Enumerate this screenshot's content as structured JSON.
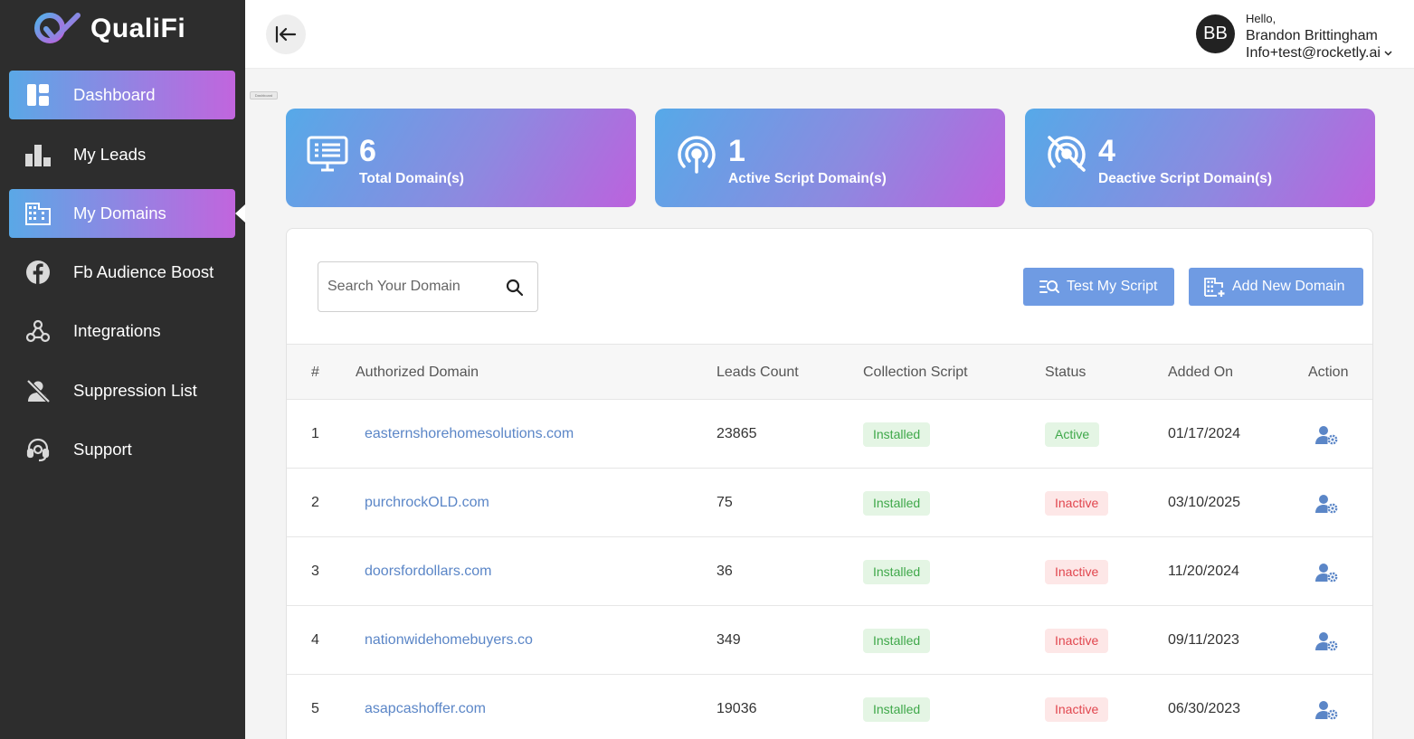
{
  "app": {
    "brand": "QualiFi"
  },
  "sidebar": {
    "items": [
      {
        "label": "Dashboard",
        "icon": "dashboard-icon"
      },
      {
        "label": "My Leads",
        "icon": "bar-chart-icon"
      },
      {
        "label": "My Domains",
        "icon": "building-icon"
      },
      {
        "label": "Fb Audience Boost",
        "icon": "facebook-icon"
      },
      {
        "label": "Integrations",
        "icon": "webhook-icon"
      },
      {
        "label": "Suppression List",
        "icon": "person-off-icon"
      },
      {
        "label": "Support",
        "icon": "headset-icon"
      }
    ],
    "tooltip": "Dashboard"
  },
  "header": {
    "avatar_initials": "BB",
    "greeting": "Hello,",
    "user_name": "Brandon Brittingham",
    "user_email": "Info+test@rocketly.ai"
  },
  "stats": [
    {
      "value": "6",
      "label": "Total Domain(s)",
      "icon": "monitor-list-icon"
    },
    {
      "value": "1",
      "label": "Active Script Domain(s)",
      "icon": "broadcast-icon"
    },
    {
      "value": "4",
      "label": "Deactive Script Domain(s)",
      "icon": "broadcast-off-icon"
    }
  ],
  "toolbar": {
    "search_placeholder": "Search Your Domain",
    "test_script_label": "Test My Script",
    "add_domain_label": "Add New Domain"
  },
  "table": {
    "headers": [
      "#",
      "Authorized Domain",
      "Leads Count",
      "Collection Script",
      "Status",
      "Added On",
      "Action"
    ],
    "rows": [
      {
        "num": "1",
        "domain": "easternshorehomesolutions.com",
        "leads": "23865",
        "script": "Installed",
        "status": "Active",
        "added": "01/17/2024"
      },
      {
        "num": "2",
        "domain": "purchrockOLD.com",
        "leads": "75",
        "script": "Installed",
        "status": "Inactive",
        "added": "03/10/2025"
      },
      {
        "num": "3",
        "domain": "doorsfordollars.com",
        "leads": "36",
        "script": "Installed",
        "status": "Inactive",
        "added": "11/20/2024"
      },
      {
        "num": "4",
        "domain": "nationwidehomebuyers.co",
        "leads": "349",
        "script": "Installed",
        "status": "Inactive",
        "added": "09/11/2023"
      },
      {
        "num": "5",
        "domain": "asapcashoffer.com",
        "leads": "19036",
        "script": "Installed",
        "status": "Inactive",
        "added": "06/30/2023"
      }
    ]
  },
  "colors": {
    "sidebar_bg": "#2d2d2d",
    "accent_blue": "#6f9be3",
    "gradient_start": "#56a9e8",
    "gradient_end": "#bc62dd",
    "link": "#5b86c7",
    "active_green": "#3fa84a",
    "inactive_red": "#e1464e"
  }
}
